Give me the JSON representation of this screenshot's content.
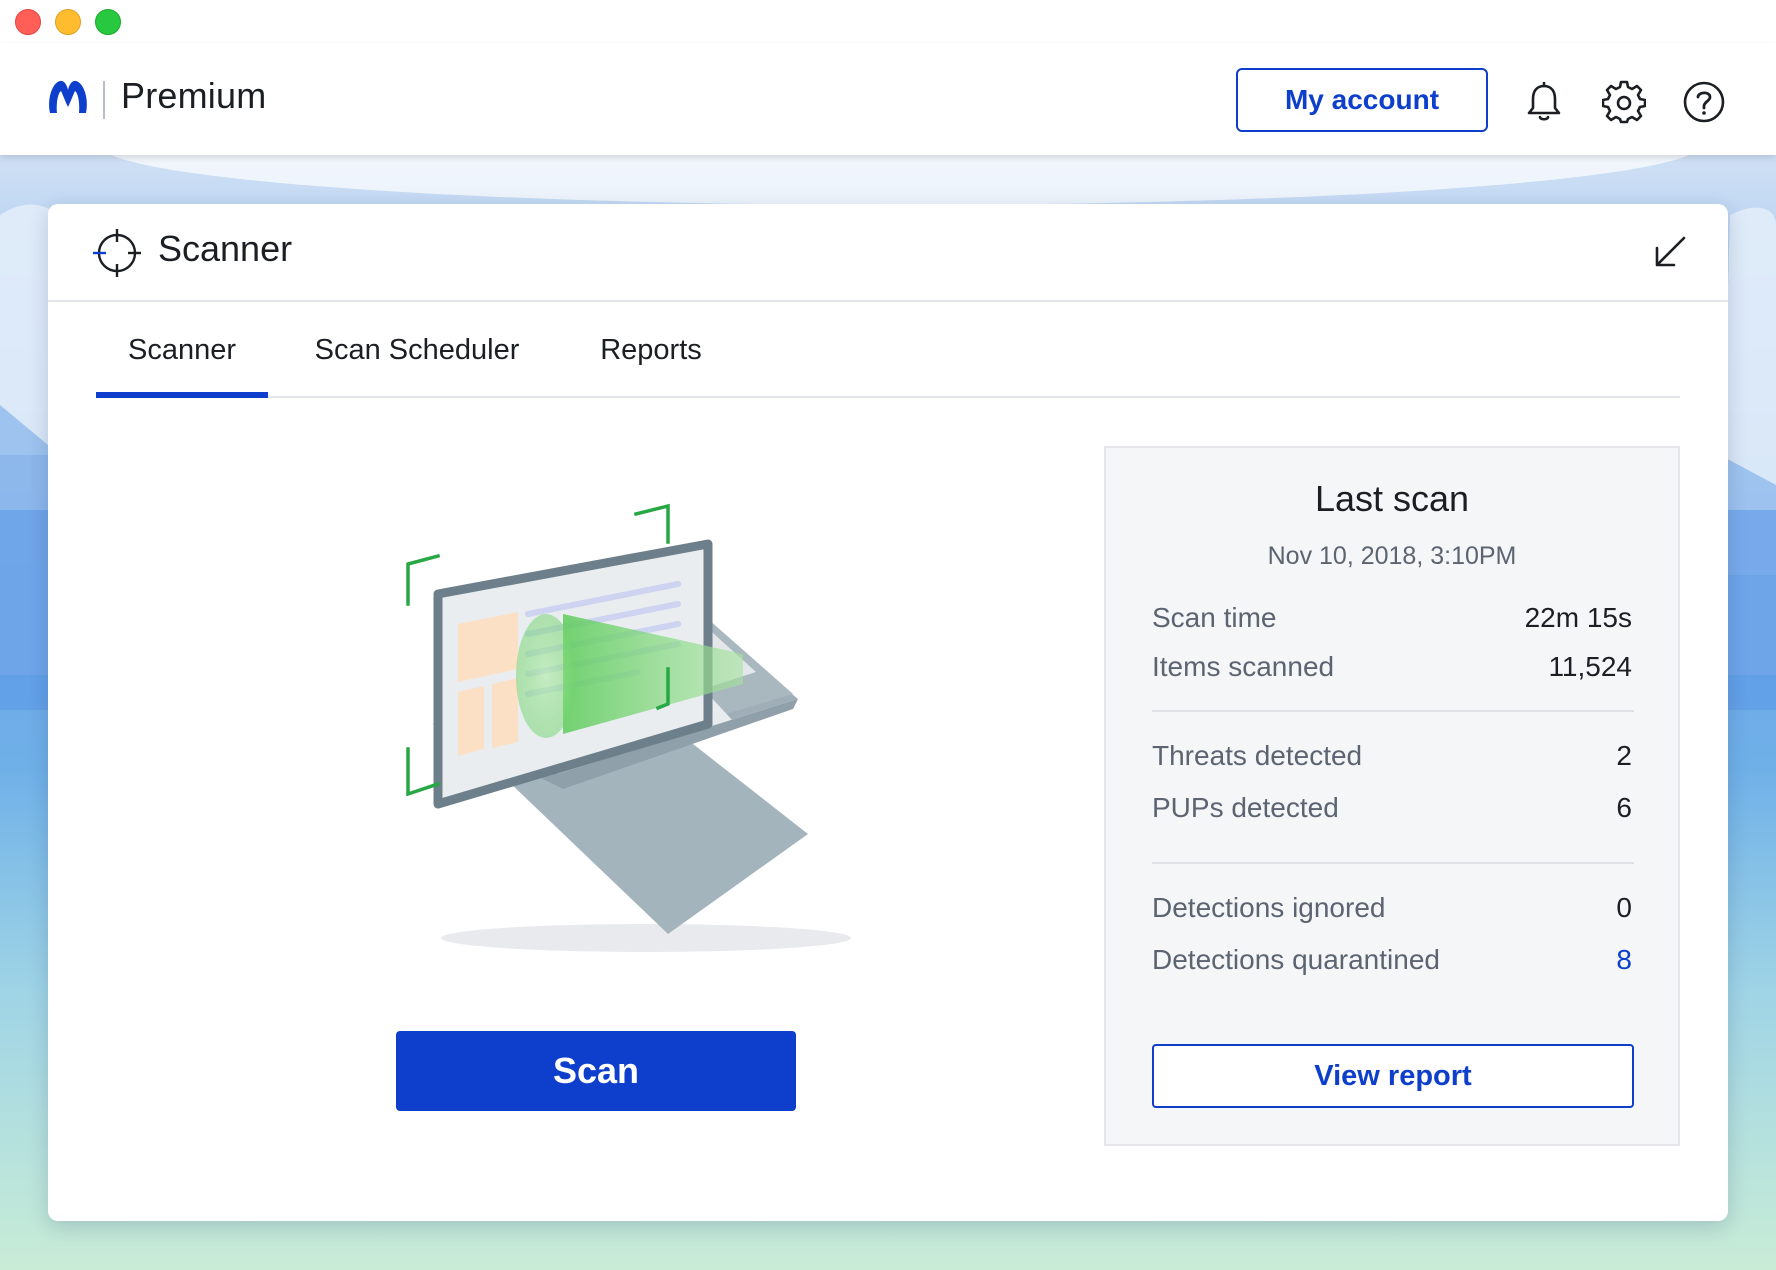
{
  "window": {
    "controls": [
      "close",
      "minimize",
      "zoom"
    ]
  },
  "header": {
    "logo_icon": "malwarebytes-logo-icon",
    "product_name": "Premium",
    "my_account_label": "My account",
    "icons": [
      "bell-icon",
      "gear-icon",
      "help-icon"
    ]
  },
  "card": {
    "title": "Scanner",
    "title_icon": "crosshair-icon",
    "minimize_icon": "arrow-down-left-icon"
  },
  "tabs": [
    {
      "label": "Scanner",
      "active": true
    },
    {
      "label": "Scan Scheduler",
      "active": false
    },
    {
      "label": "Reports",
      "active": false
    }
  ],
  "scan_button_label": "Scan",
  "last_scan": {
    "title": "Last scan",
    "date": "Nov 10, 2018,  3:10PM",
    "stats": [
      {
        "label": "Scan time",
        "value": "22m 15s"
      },
      {
        "label": "Items scanned",
        "value": "11,524"
      },
      {
        "label": "Threats detected",
        "value": "2"
      },
      {
        "label": "PUPs detected",
        "value": "6"
      },
      {
        "label": "Detections ignored",
        "value": "0"
      },
      {
        "label": "Detections quarantined",
        "value": "8"
      }
    ],
    "view_report_label": "View report"
  },
  "colors": {
    "accent": "#0d3ecc",
    "scan_beam": "#6fd36a",
    "bracket": "#28a745"
  }
}
